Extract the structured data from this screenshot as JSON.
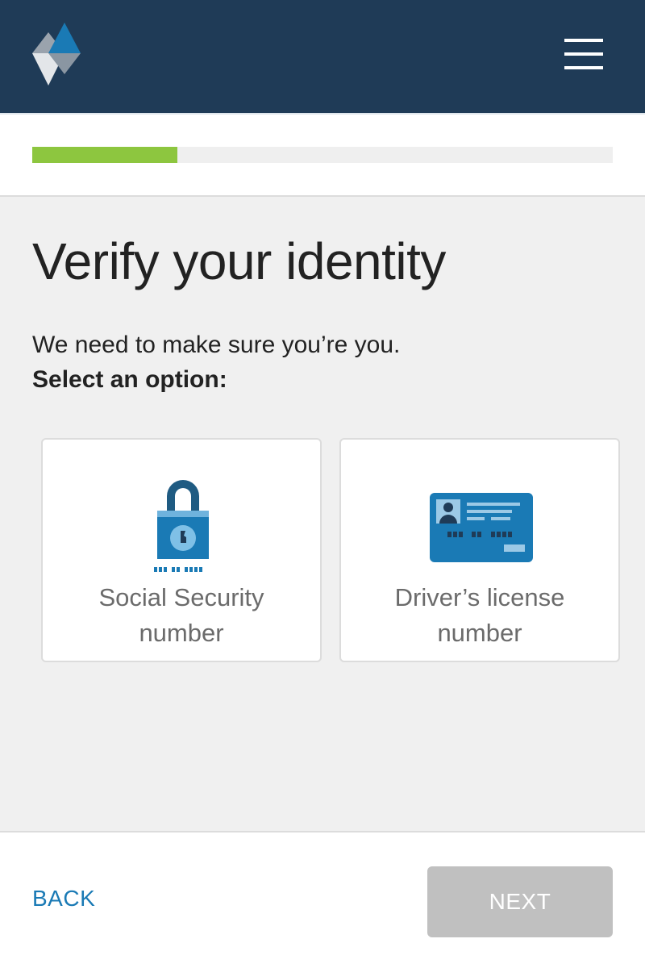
{
  "header": {
    "logo_icon": "diamond-logo-icon",
    "menu_icon": "hamburger-menu-icon",
    "background_color": "#1f3b57"
  },
  "progress": {
    "fraction": 0.25,
    "fill_color": "#8dc63f",
    "track_color": "#efefef"
  },
  "main": {
    "title": "Verify your identity",
    "subtitle": "We need to make sure you’re you.",
    "select_label": "Select an option:"
  },
  "options": [
    {
      "icon": "padlock-icon",
      "label": "Social Security number"
    },
    {
      "icon": "id-card-icon",
      "label": "Driver’s license number"
    }
  ],
  "footer": {
    "back_label": "BACK",
    "next_label": "NEXT",
    "back_color": "#1a7ab5",
    "next_disabled_color": "#c0c0c0"
  }
}
